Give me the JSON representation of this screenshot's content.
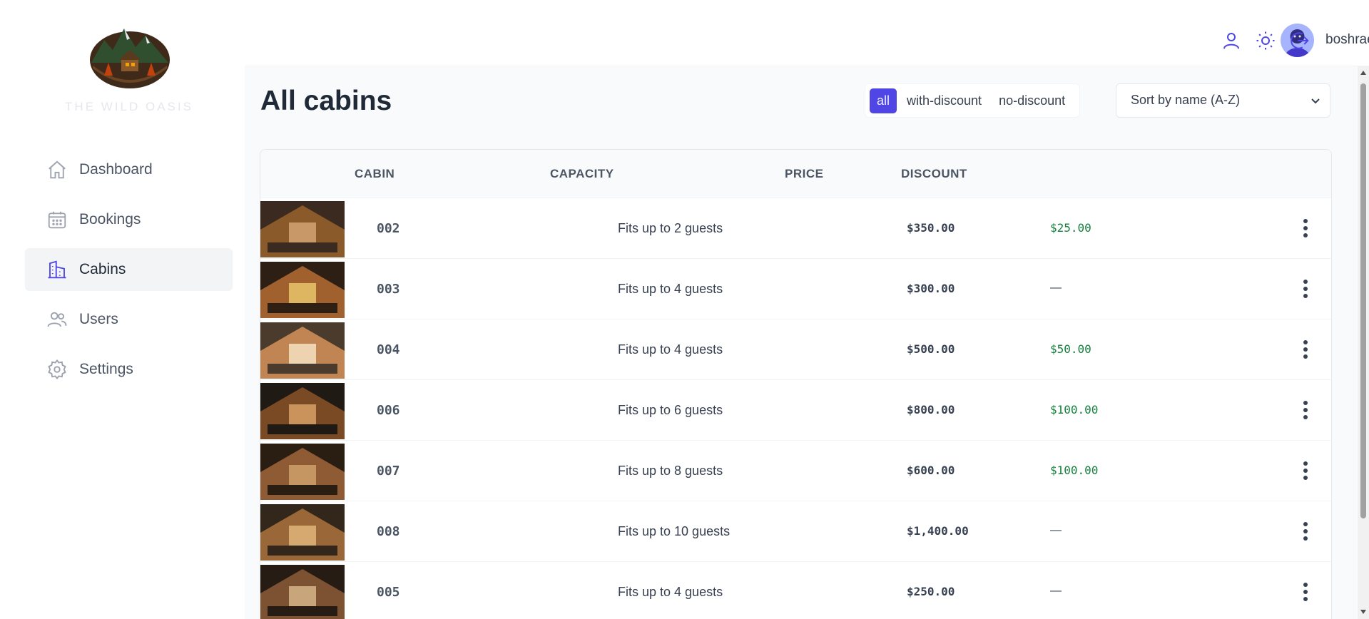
{
  "brand": {
    "name": "THE WILD OASIS"
  },
  "sidebar": {
    "items": [
      {
        "label": "Dashboard",
        "icon": "home-icon",
        "active": false
      },
      {
        "label": "Bookings",
        "icon": "calendar-icon",
        "active": false
      },
      {
        "label": "Cabins",
        "icon": "buildings-icon",
        "active": true
      },
      {
        "label": "Users",
        "icon": "users-icon",
        "active": false
      },
      {
        "label": "Settings",
        "icon": "gear-icon",
        "active": false
      }
    ]
  },
  "header": {
    "username": "boshraemadawad",
    "icons": [
      "account-icon",
      "sun-icon",
      "logout-icon"
    ]
  },
  "main": {
    "title": "All cabins",
    "filter": {
      "options": [
        "all",
        "with-discount",
        "no-discount"
      ],
      "selected": "all"
    },
    "sort": {
      "selected": "Sort by name (A-Z)"
    },
    "table": {
      "columns": [
        "",
        "CABIN",
        "CAPACITY",
        "PRICE",
        "DISCOUNT"
      ],
      "rows": [
        {
          "name": "002",
          "capacity": "Fits up to 2 guests",
          "price": "$350.00",
          "discount": "$25.00"
        },
        {
          "name": "003",
          "capacity": "Fits up to 4 guests",
          "price": "$300.00",
          "discount": "—"
        },
        {
          "name": "004",
          "capacity": "Fits up to 4 guests",
          "price": "$500.00",
          "discount": "$50.00"
        },
        {
          "name": "006",
          "capacity": "Fits up to 6 guests",
          "price": "$800.00",
          "discount": "$100.00"
        },
        {
          "name": "007",
          "capacity": "Fits up to 8 guests",
          "price": "$600.00",
          "discount": "$100.00"
        },
        {
          "name": "008",
          "capacity": "Fits up to 10 guests",
          "price": "$1,400.00",
          "discount": "—"
        },
        {
          "name": "005",
          "capacity": "Fits up to 4 guests",
          "price": "$250.00",
          "discount": "—"
        }
      ]
    }
  },
  "colors": {
    "accent": "#4f46e5",
    "discount": "#15803d",
    "background": "#f9fafb"
  }
}
